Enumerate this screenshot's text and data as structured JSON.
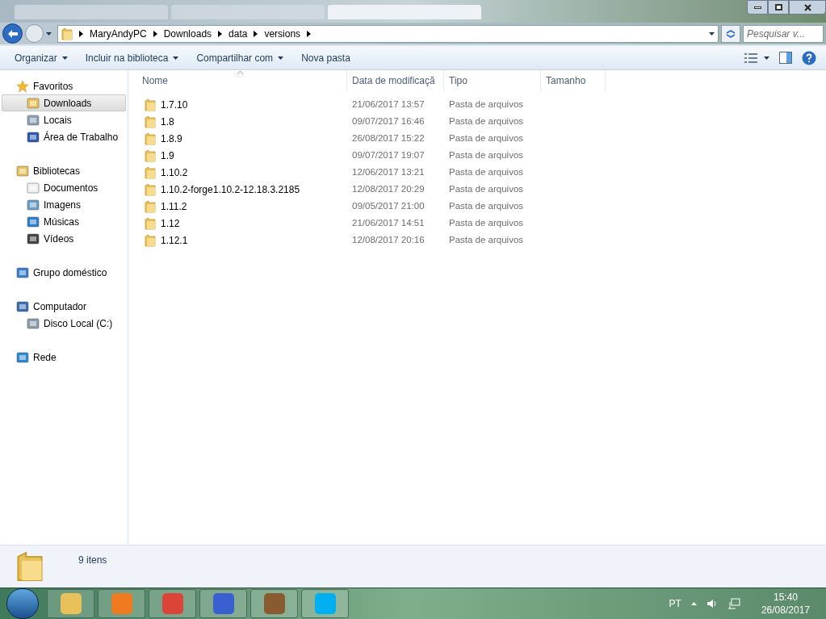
{
  "address": {
    "crumbs": [
      "MaryAndyPC",
      "Downloads",
      "data",
      "versions"
    ],
    "search_placeholder": "Pesquisar v..."
  },
  "toolbar": [
    {
      "label": "Organizar",
      "menu": true
    },
    {
      "label": "Incluir na biblioteca",
      "menu": true
    },
    {
      "label": "Compartilhar com",
      "menu": true
    },
    {
      "label": "Nova pasta",
      "menu": false
    }
  ],
  "sidebar": [
    {
      "label": "Favoritos",
      "children": [
        {
          "label": "Downloads",
          "selected": true
        },
        {
          "label": "Locais",
          "selected": false
        },
        {
          "label": "Área de Trabalho",
          "selected": false
        }
      ]
    },
    {
      "label": "Bibliotecas",
      "children": [
        {
          "label": "Documentos",
          "selected": false
        },
        {
          "label": "Imagens",
          "selected": false
        },
        {
          "label": "Músicas",
          "selected": false
        },
        {
          "label": "Vídeos",
          "selected": false
        }
      ]
    },
    {
      "label": "Grupo doméstico"
    },
    {
      "label": "Computador",
      "children": [
        {
          "label": "Disco Local (C:)",
          "selected": false
        }
      ]
    },
    {
      "label": "Rede"
    }
  ],
  "table": {
    "columns": [
      "Nome",
      "Data de modificaçã",
      "Tipo",
      "Tamanho"
    ],
    "rows": [
      [
        "1.7.10",
        "21/06/2017 13:57",
        "Pasta de arquivos"
      ],
      [
        "1.8",
        "09/07/2017 16:46",
        "Pasta de arquivos"
      ],
      [
        "1.8.9",
        "26/08/2017 15:22",
        "Pasta de arquivos"
      ],
      [
        "1.9",
        "09/07/2017 19:07",
        "Pasta de arquivos"
      ],
      [
        "1.10.2",
        "12/06/2017 13:21",
        "Pasta de arquivos"
      ],
      [
        "1.10.2-forge1.10.2-12.18.3.2185",
        "12/08/2017 20:29",
        "Pasta de arquivos"
      ],
      [
        "1.11.2",
        "09/05/2017 21:00",
        "Pasta de arquivos"
      ],
      [
        "1.12",
        "21/06/2017 14:51",
        "Pasta de arquivos"
      ],
      [
        "1.12.1",
        "12/08/2017 20:16",
        "Pasta de arquivos"
      ]
    ]
  },
  "status": "9 itens",
  "taskbar": {
    "language": "PT",
    "time": "15:40",
    "date": "26/08/2017"
  }
}
